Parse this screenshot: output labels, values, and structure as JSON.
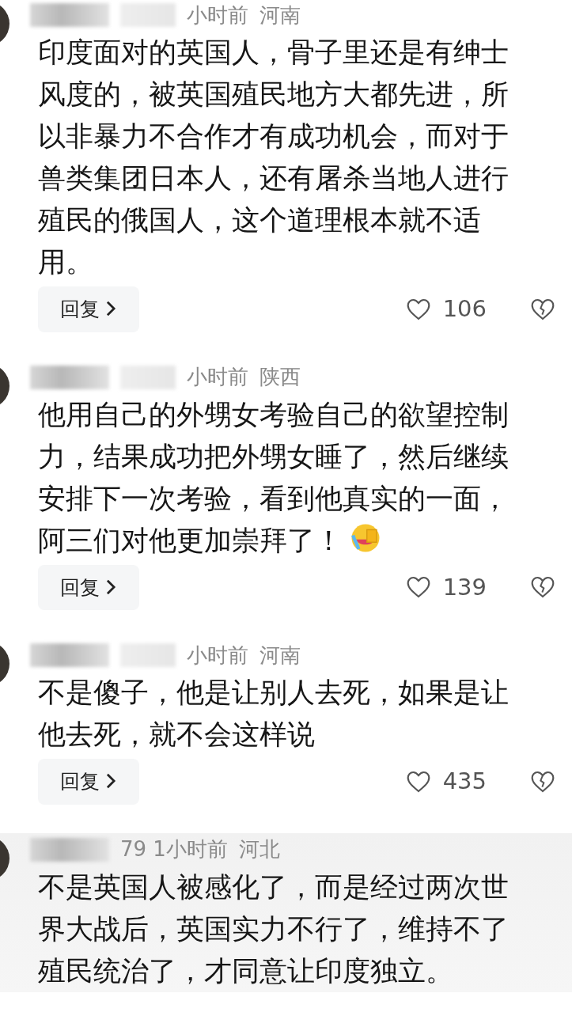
{
  "comments": [
    {
      "meta": "小时前",
      "location": "河南",
      "text": "印度面对的英国人，骨子里还是有绅士风度的，被英国殖民地方大都先进，所以非暴力不合作才有成功机会，而对于兽类集团日本人，还有屠杀当地人进行殖民的俄国人，这个道理根本就不适用。",
      "reply": "回复",
      "likes": "106",
      "emoji": false,
      "shaded": false
    },
    {
      "meta": "小时前",
      "location": "陕西",
      "text": "他用自己的外甥女考验自己的欲望控制力，结果成功把外甥女睡了，然后继续安排下一次考验，看到他真实的一面，阿三们对他更加崇拜了！",
      "reply": "回复",
      "likes": "139",
      "emoji": true,
      "shaded": false
    },
    {
      "meta": "小时前",
      "location": "河南",
      "text": "不是傻子，他是让别人去死，如果是让他去死，就不会这样说",
      "reply": "回复",
      "likes": "435",
      "emoji": false,
      "shaded": false
    },
    {
      "meta": "79  1小时前",
      "location": "河北",
      "text": "不是英国人被感化了，而是经过两次世界大战后，英国实力不行了，维持不了殖民统治了，才同意让印度独立。",
      "emoji": false,
      "shaded": true
    }
  ]
}
